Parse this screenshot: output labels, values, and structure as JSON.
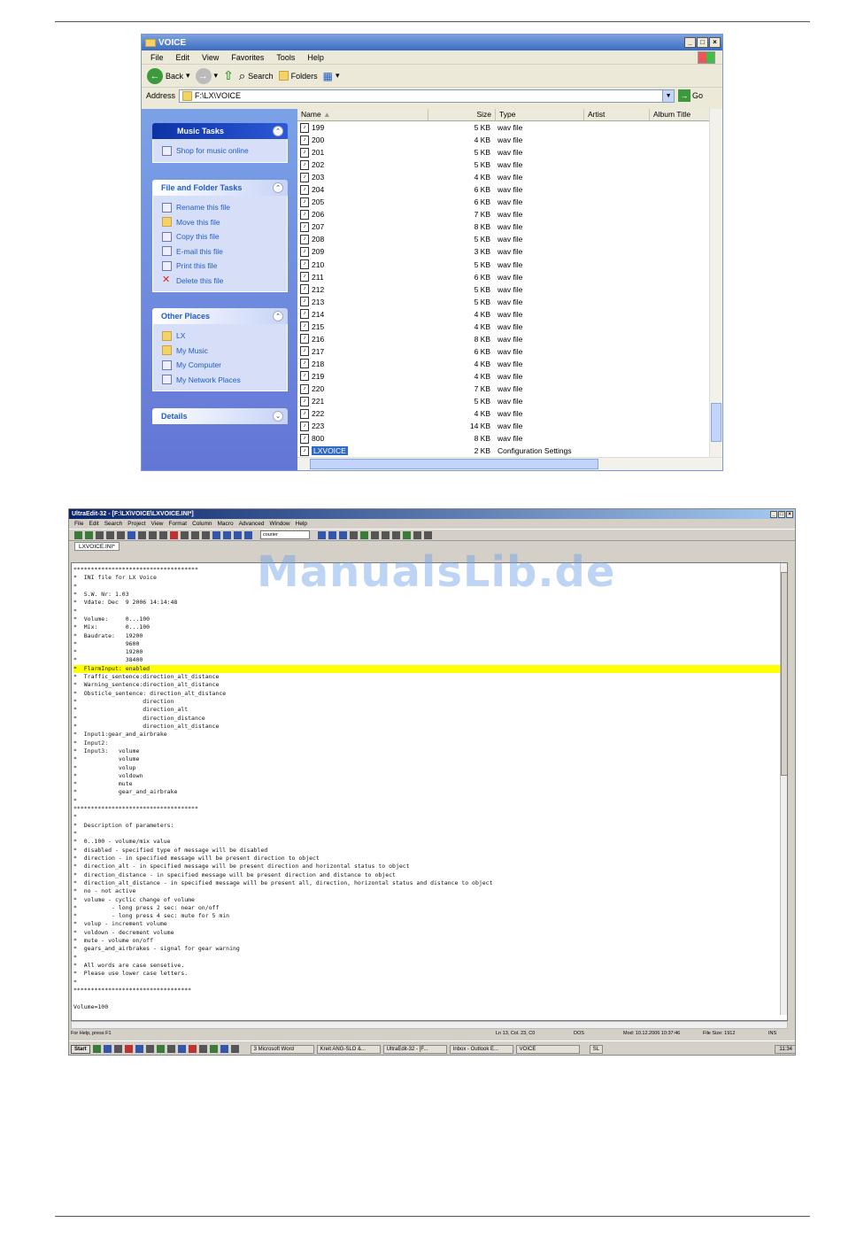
{
  "explorer": {
    "title": "VOICE",
    "menu": [
      "File",
      "Edit",
      "View",
      "Favorites",
      "Tools",
      "Help"
    ],
    "toolbar": {
      "back": "Back",
      "search": "Search",
      "folders": "Folders"
    },
    "address_label": "Address",
    "address_value": "F:\\LX\\VOICE",
    "go_label": "Go",
    "music_tasks": {
      "title": "Music Tasks",
      "items": [
        "Shop for music online"
      ]
    },
    "file_tasks": {
      "title": "File and Folder Tasks",
      "items": [
        "Rename this file",
        "Move this file",
        "Copy this file",
        "E-mail this file",
        "Print this file",
        "Delete this file"
      ]
    },
    "other_places": {
      "title": "Other Places",
      "items": [
        "LX",
        "My Music",
        "My Computer",
        "My Network Places"
      ]
    },
    "details": {
      "title": "Details"
    },
    "columns": [
      "Name",
      "Size",
      "Type",
      "Artist",
      "Album Title"
    ],
    "files": [
      {
        "name": "199",
        "size": "5 KB",
        "type": "wav file"
      },
      {
        "name": "200",
        "size": "4 KB",
        "type": "wav file"
      },
      {
        "name": "201",
        "size": "5 KB",
        "type": "wav file"
      },
      {
        "name": "202",
        "size": "5 KB",
        "type": "wav file"
      },
      {
        "name": "203",
        "size": "4 KB",
        "type": "wav file"
      },
      {
        "name": "204",
        "size": "6 KB",
        "type": "wav file"
      },
      {
        "name": "205",
        "size": "6 KB",
        "type": "wav file"
      },
      {
        "name": "206",
        "size": "7 KB",
        "type": "wav file"
      },
      {
        "name": "207",
        "size": "8 KB",
        "type": "wav file"
      },
      {
        "name": "208",
        "size": "5 KB",
        "type": "wav file"
      },
      {
        "name": "209",
        "size": "3 KB",
        "type": "wav file"
      },
      {
        "name": "210",
        "size": "5 KB",
        "type": "wav file"
      },
      {
        "name": "211",
        "size": "6 KB",
        "type": "wav file"
      },
      {
        "name": "212",
        "size": "5 KB",
        "type": "wav file"
      },
      {
        "name": "213",
        "size": "5 KB",
        "type": "wav file"
      },
      {
        "name": "214",
        "size": "4 KB",
        "type": "wav file"
      },
      {
        "name": "215",
        "size": "4 KB",
        "type": "wav file"
      },
      {
        "name": "216",
        "size": "8 KB",
        "type": "wav file"
      },
      {
        "name": "217",
        "size": "6 KB",
        "type": "wav file"
      },
      {
        "name": "218",
        "size": "4 KB",
        "type": "wav file"
      },
      {
        "name": "219",
        "size": "4 KB",
        "type": "wav file"
      },
      {
        "name": "220",
        "size": "7 KB",
        "type": "wav file"
      },
      {
        "name": "221",
        "size": "5 KB",
        "type": "wav file"
      },
      {
        "name": "222",
        "size": "4 KB",
        "type": "wav file"
      },
      {
        "name": "223",
        "size": "14 KB",
        "type": "wav file"
      },
      {
        "name": "800",
        "size": "8 KB",
        "type": "wav file"
      },
      {
        "name": "LXVOICE",
        "size": "2 KB",
        "type": "Configuration Settings",
        "selected": true
      }
    ]
  },
  "ultraedit": {
    "title": "UltraEdit-32 - [F:\\LX\\VOICE\\LXVOICE.INI*]",
    "menu": [
      "File",
      "Edit",
      "Search",
      "Project",
      "View",
      "Format",
      "Column",
      "Macro",
      "Advanced",
      "Window",
      "Help"
    ],
    "font_select": "courier",
    "tab": "LXVOICE.INI*",
    "lines": [
      "************************************",
      "*  INI file for LX Voice",
      "*",
      "*  S.W. Nr: 1.03",
      "*  Vdate: Dec  9 2006 14:14:48",
      "*",
      "*  Volume:     0...100",
      "*  Mix:        0...100",
      "*  Baudrate:   19200",
      "*              9600",
      "*              19200",
      "*              38400",
      "*  FlarmInput: enabled",
      "*  Traffic_sentence:direction_alt_distance",
      "*  Warning_sentence:direction_alt_distance",
      "*  Obsticle_sentence: direction_alt_distance",
      "*                   direction",
      "*                   direction_alt",
      "*                   direction_distance",
      "*                   direction_alt_distance",
      "*  Input1:gear_and_airbrake",
      "*  Input2:",
      "*  Input3:   volume",
      "*            volume",
      "*            volup",
      "*            voldown",
      "*            mute",
      "*            gear_and_airbrake",
      "*",
      "************************************",
      "*",
      "*  Description of parameters:",
      "*",
      "*  0..100 - volume/mix value",
      "*  disabled - specified type of message will be disabled",
      "*  direction - in specified message will be present direction to object",
      "*  direction_alt - in specified message will be present direction and horizontal status to object",
      "*  direction_distance - in specified message will be present direction and distance to object",
      "*  direction_alt_distance - in specified message will be present all, direction, horizontal status and distance to object",
      "*  no - not active",
      "*  volume - cyclic change of volume",
      "*          - long press 2 sec: near on/off",
      "*          - long press 4 sec: mute for 5 min",
      "*  volup - increment volume",
      "*  voldown - decrement volume",
      "*  mute - volume on/off",
      "*  gears_and_airbrakes - signal for gear warning",
      "*",
      "*  All words are case sensetive.",
      "*  Please use lower case letters.",
      "*",
      "**********************************",
      "",
      "Volume=100"
    ],
    "highlight_line": 12,
    "status": {
      "help": "For Help, press F1",
      "position": "Ln 13, Col. 23, C0",
      "format": "DOS",
      "modified": "Mod: 10.12.2006 10:37:46",
      "file_size": "File Size: 1912",
      "mode": "INS"
    },
    "taskbar": {
      "start": "Start",
      "buttons": [
        "3 Microsoft Word",
        "Kreit ANG-SLO &...",
        "UltraEdit-32 - [F...",
        "Inbox - Outlook E...",
        "VOICE"
      ],
      "clock": "11:34",
      "lang": "SL"
    }
  },
  "watermark": "ManualsLib.de"
}
